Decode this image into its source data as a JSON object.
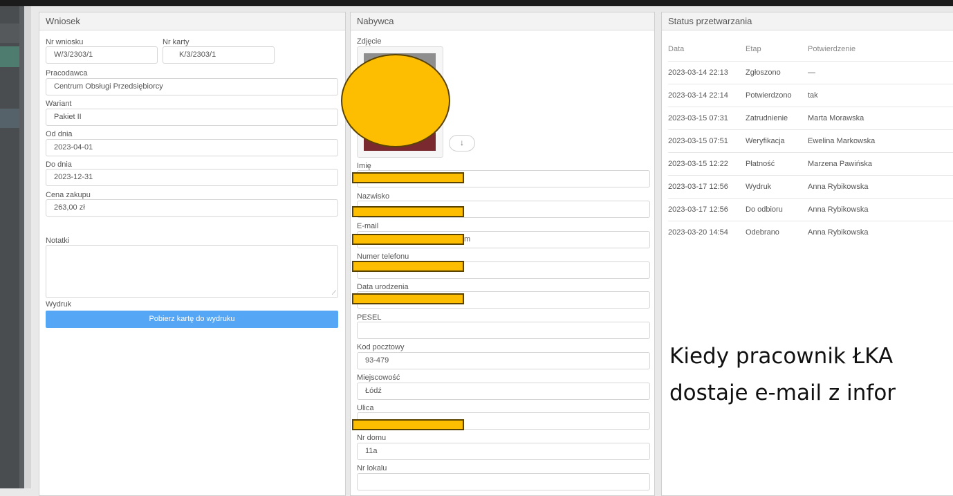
{
  "wniosek": {
    "title": "Wniosek",
    "nr_wniosku_label": "Nr wniosku",
    "nr_wniosku": "W/3/2303/1",
    "nr_karty_label": "Nr karty",
    "nr_karty": "K/3/2303/1",
    "pracodawca_label": "Pracodawca",
    "pracodawca": "Centrum Obsługi Przedsiębiorcy",
    "wariant_label": "Wariant",
    "wariant": "Pakiet II",
    "od_dnia_label": "Od dnia",
    "od_dnia": "2023-04-01",
    "do_dnia_label": "Do dnia",
    "do_dnia": "2023-12-31",
    "cena_label": "Cena zakupu",
    "cena": "263,00 zł",
    "notatki_label": "Notatki",
    "wydruk_label": "Wydruk",
    "print_button": "Pobierz kartę do wydruku"
  },
  "nabywca": {
    "title": "Nabywca",
    "zdjecie_label": "Zdjęcie",
    "download_icon": "↓",
    "imie_label": "Imię",
    "nazwisko_label": "Nazwisko",
    "email_label": "E-mail",
    "email_visible_tail": "m",
    "telefon_label": "Numer telefonu",
    "data_urodzenia_label": "Data urodzenia",
    "pesel_label": "PESEL",
    "kod_label": "Kod pocztowy",
    "kod": "93-479",
    "miejscowosc_label": "Miejscowość",
    "miejscowosc": "Łódź",
    "ulica_label": "Ulica",
    "nr_domu_label": "Nr domu",
    "nr_domu": "11a",
    "nr_lokalu_label": "Nr lokalu"
  },
  "status": {
    "title": "Status przetwarzania",
    "headers": [
      "Data",
      "Etap",
      "Potwierdzenie"
    ],
    "rows": [
      {
        "data": "2023-03-14 22:13",
        "etap": "Zgłoszono",
        "potw": "—"
      },
      {
        "data": "2023-03-14 22:14",
        "etap": "Potwierdzono",
        "potw": "tak"
      },
      {
        "data": "2023-03-15 07:31",
        "etap": "Zatrudnienie",
        "potw": "Marta Morawska"
      },
      {
        "data": "2023-03-15 07:51",
        "etap": "Weryfikacja",
        "potw": "Ewelina Markowska"
      },
      {
        "data": "2023-03-15 12:22",
        "etap": "Płatność",
        "potw": "Marzena Pawińska"
      },
      {
        "data": "2023-03-17 12:56",
        "etap": "Wydruk",
        "potw": "Anna Rybikowska"
      },
      {
        "data": "2023-03-17 12:56",
        "etap": "Do odbioru",
        "potw": "Anna Rybikowska"
      },
      {
        "data": "2023-03-20 14:54",
        "etap": "Odebrano",
        "potw": "Anna Rybikowska"
      }
    ]
  },
  "overlay": {
    "line1": "Kiedy pracownik ŁKA",
    "line2": "dostaje e-mail z infor"
  },
  "colors": {
    "accent_button": "#55a6f5",
    "redaction": "#fdbd00"
  }
}
